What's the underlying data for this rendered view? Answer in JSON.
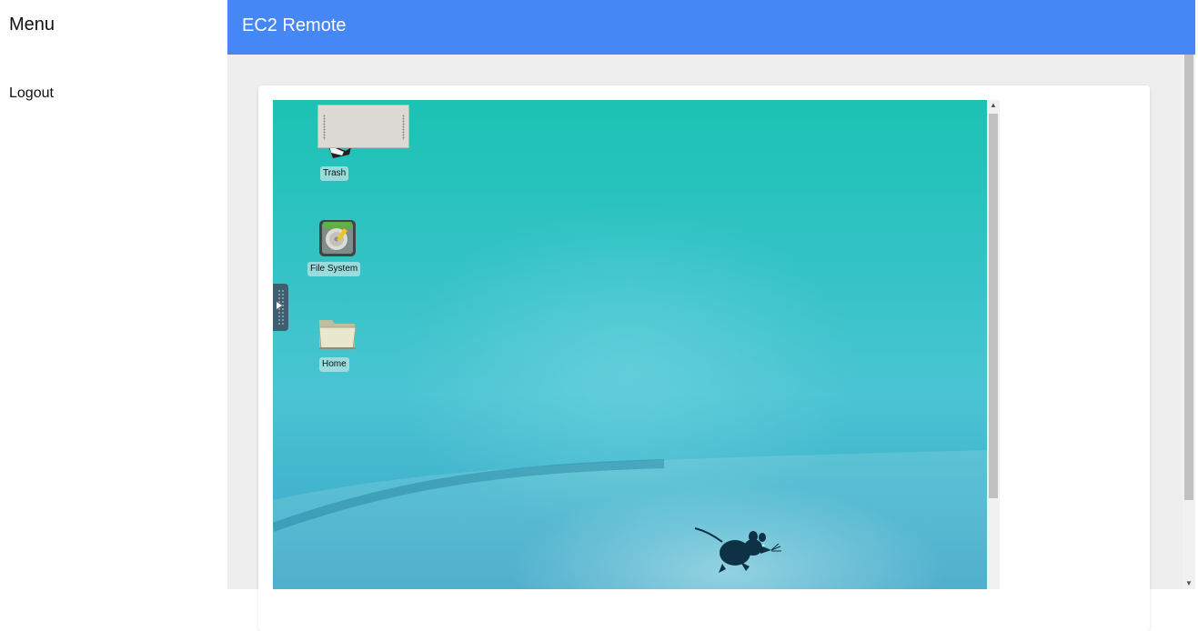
{
  "sidebar": {
    "title": "Menu",
    "logout_label": "Logout"
  },
  "header": {
    "title": "EC2 Remote"
  },
  "remote_desktop": {
    "icons": [
      {
        "label": "Trash",
        "icon": "trash-icon"
      },
      {
        "label": "File System",
        "icon": "hard-drive-icon"
      },
      {
        "label": "Home",
        "icon": "folder-icon"
      }
    ],
    "wallpaper_logo": "xfce-mouse-logo"
  },
  "colors": {
    "header_bg": "#4487f5",
    "main_bg": "#eeeeee",
    "desktop_teal": "#1bc2b3"
  }
}
